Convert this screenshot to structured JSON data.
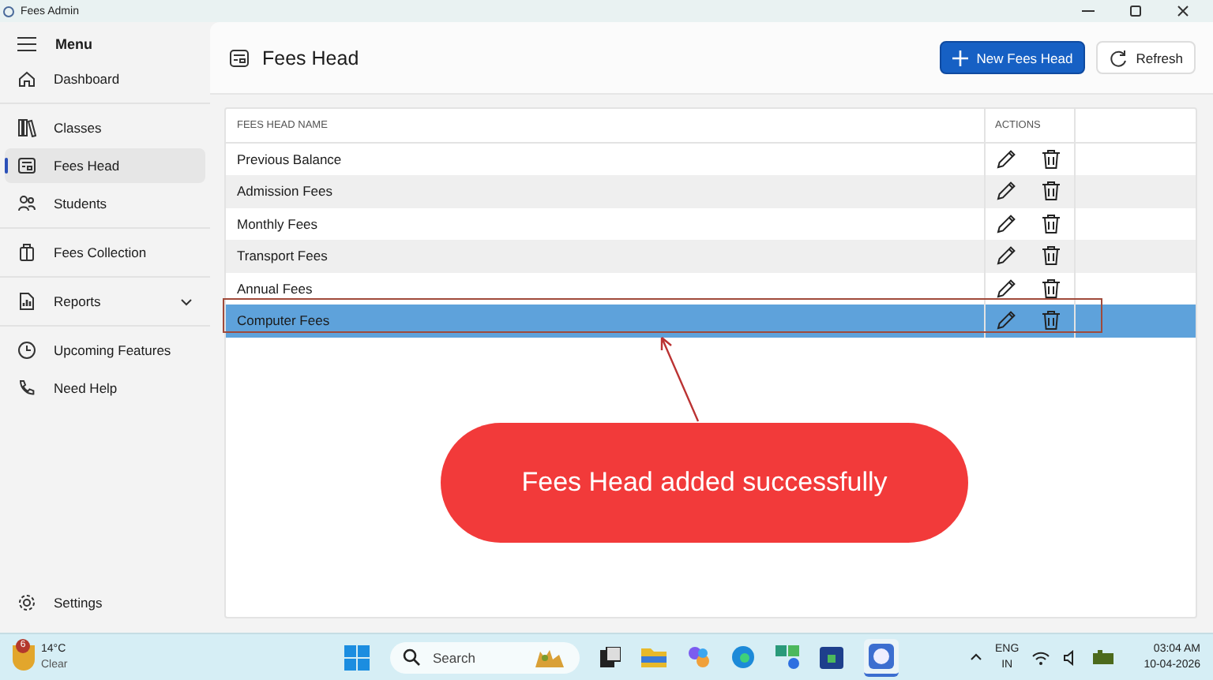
{
  "window": {
    "title": "Fees Admin"
  },
  "sidebar": {
    "menu_label": "Menu",
    "items": [
      {
        "label": "Dashboard",
        "selected": false
      },
      {
        "label": "Classes",
        "selected": false
      },
      {
        "label": "Fees Head",
        "selected": true
      },
      {
        "label": "Students",
        "selected": false
      },
      {
        "label": "Fees Collection",
        "selected": false
      },
      {
        "label": "Reports",
        "selected": false,
        "expandable": true
      },
      {
        "label": "Upcoming Features",
        "selected": false
      },
      {
        "label": "Need Help",
        "selected": false
      }
    ],
    "settings": "Settings"
  },
  "header": {
    "title": "Fees Head",
    "buttons": [
      {
        "label": "New Fees Head",
        "kind": "primary"
      },
      {
        "label": "Refresh",
        "kind": "secondary"
      }
    ]
  },
  "table": {
    "columns": [
      "FEES HEAD NAME",
      "ACTIONS"
    ],
    "rows": [
      {
        "name": "Previous Balance",
        "selected": false
      },
      {
        "name": "Admission Fees",
        "selected": false
      },
      {
        "name": "Monthly Fees",
        "selected": false
      },
      {
        "name": "Transport Fees",
        "selected": false
      },
      {
        "name": "Annual Fees",
        "selected": false
      },
      {
        "name": "Computer Fees",
        "selected": true
      }
    ]
  },
  "callout": {
    "text": "Fees Head added successfully"
  },
  "taskbar": {
    "weather": {
      "badge": "6",
      "temp": "14°C",
      "condition": "Clear"
    },
    "search_placeholder": "Search",
    "language": "ENG",
    "region": "IN",
    "time": "03:04 AM",
    "date": "10-04-2026"
  }
}
